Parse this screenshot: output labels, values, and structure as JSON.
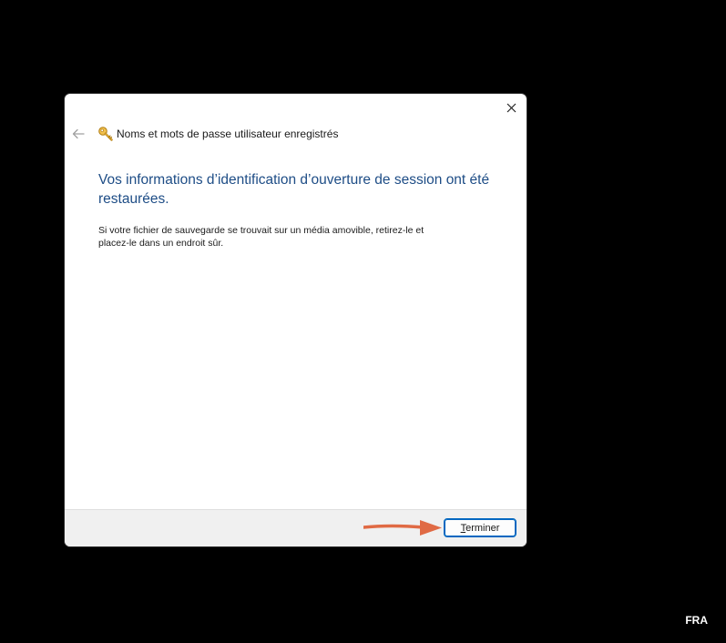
{
  "dialog": {
    "title": "Noms et mots de passe utilisateur enregistrés",
    "heading": "Vos informations d’identification d’ouverture de session ont été restaurées.",
    "message": "Si votre fichier de sauvegarde se trouvait sur un média amovible, retirez-le et placez-le dans un endroit sûr.",
    "finish_label": "Terminer",
    "close_icon": "close-icon",
    "back_icon": "back-arrow-icon",
    "title_icon": "key-icon"
  },
  "annotation": {
    "arrow_color": "#e06a44",
    "points_to": "finish-button"
  },
  "taskbar": {
    "language": "FRA"
  },
  "colors": {
    "heading": "#1e4d86",
    "accent": "#0067c0",
    "footer": "#f0f0f0",
    "background": "#000000"
  }
}
